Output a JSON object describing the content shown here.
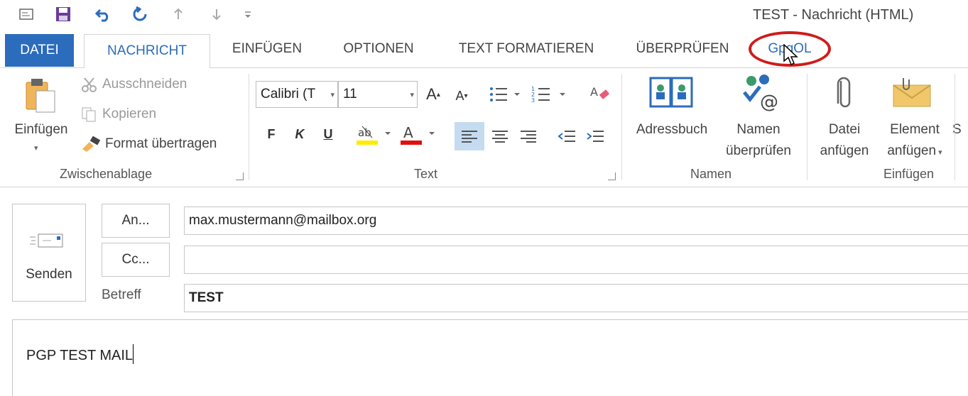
{
  "window": {
    "title": "TEST - Nachricht (HTML)"
  },
  "tabs": [
    "DATEI",
    "NACHRICHT",
    "EINFÜGEN",
    "OPTIONEN",
    "TEXT FORMATIEREN",
    "ÜBERPRÜFEN",
    "GpgOL"
  ],
  "ribbon": {
    "clipboard": {
      "paste": "Einfügen",
      "cut": "Ausschneiden",
      "copy": "Kopieren",
      "format_painter": "Format übertragen",
      "group": "Zwischenablage"
    },
    "text": {
      "font": "Calibri (T",
      "size": "11",
      "bold": "F",
      "italic": "K",
      "underline": "U",
      "group": "Text"
    },
    "names": {
      "address_book": "Adressbuch",
      "check_names_1": "Namen",
      "check_names_2": "überprüfen",
      "group": "Namen"
    },
    "include": {
      "attach_file_1": "Datei",
      "attach_file_2": "anfügen",
      "attach_item_1": "Element",
      "attach_item_2": "anfügen",
      "more": "S",
      "group": "Einfügen"
    }
  },
  "compose": {
    "send": "Senden",
    "to_btn": "An...",
    "cc_btn": "Cc...",
    "subject_label": "Betreff",
    "to_value": "max.mustermann@mailbox.org",
    "cc_value": "",
    "subject_value": "TEST",
    "body": "PGP TEST MAIL"
  },
  "colors": {
    "accent": "#2b6cbd",
    "highlight_ring": "#d11a1a",
    "highlight_yellow": "#ffeb00",
    "font_red": "#e01010"
  }
}
